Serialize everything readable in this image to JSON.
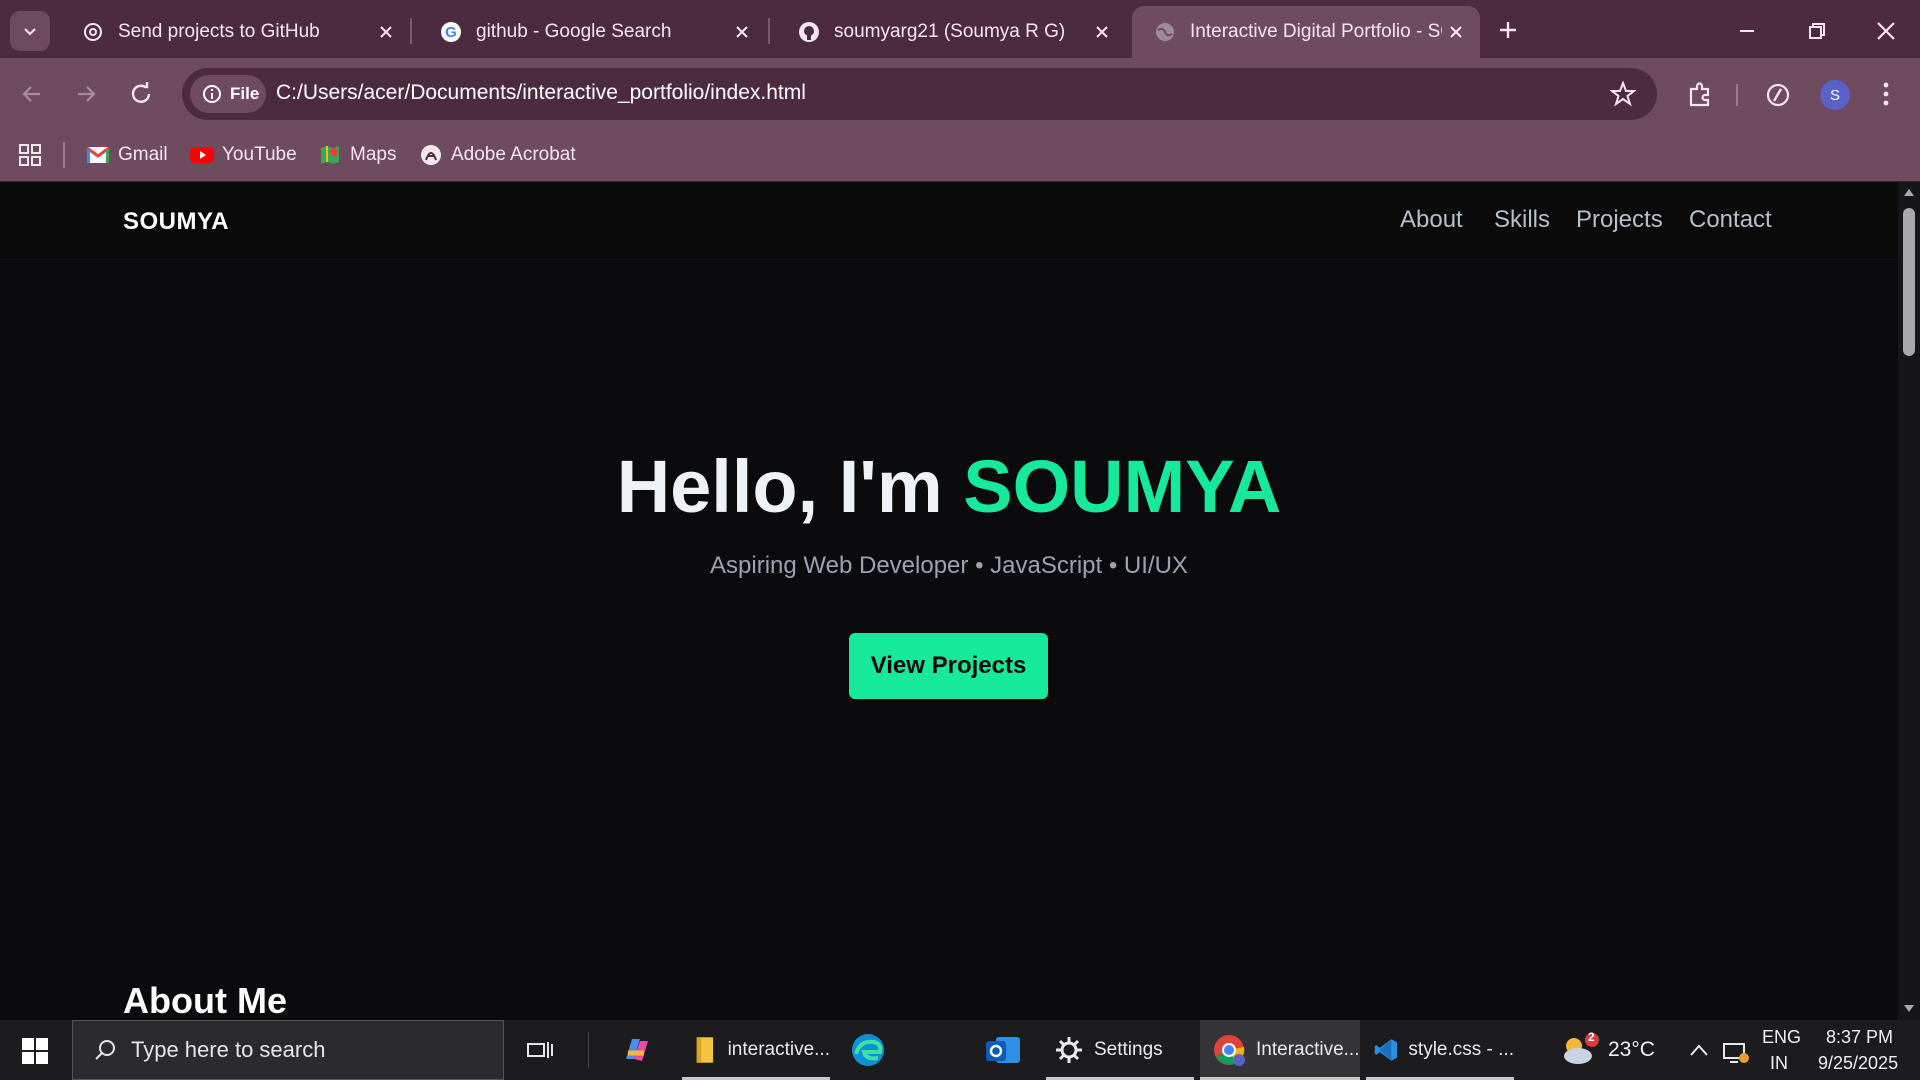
{
  "browser": {
    "tabs": [
      {
        "title": "Send projects to GitHub",
        "favicon": "openai-icon"
      },
      {
        "title": "github - Google Search",
        "favicon": "google-icon"
      },
      {
        "title": "soumyarg21 (Soumya R G)",
        "favicon": "github-icon"
      },
      {
        "title": "Interactive Digital Portfolio - SO",
        "favicon": "globe-icon",
        "active": true
      }
    ],
    "address": {
      "chip": "File",
      "url": "C:/Users/acer/Documents/interactive_portfolio/index.html"
    },
    "profile_initial": "S",
    "bookmarks": [
      {
        "label": "Gmail",
        "icon": "gmail-icon"
      },
      {
        "label": "YouTube",
        "icon": "youtube-icon"
      },
      {
        "label": "Maps",
        "icon": "maps-icon"
      },
      {
        "label": "Adobe Acrobat",
        "icon": "acrobat-icon"
      }
    ]
  },
  "site": {
    "brand": "SOUMYA",
    "nav": [
      "About",
      "Skills",
      "Projects",
      "Contact"
    ],
    "hero": {
      "greeting": "Hello, I'm ",
      "name": "SOUMYA",
      "subtitle": "Aspiring Web Developer • JavaScript • UI/UX",
      "cta": "View Projects"
    },
    "about_heading": "About Me",
    "colors": {
      "accent": "#16e89c",
      "background": "#0b0b0e"
    }
  },
  "taskbar": {
    "search_placeholder": "Type here to search",
    "apps": [
      {
        "label": "",
        "icon": "copilot-icon"
      },
      {
        "label": "interactive...",
        "icon": "folder-icon"
      },
      {
        "label": "",
        "icon": "edge-icon"
      },
      {
        "label": "",
        "icon": "outlook-icon"
      },
      {
        "label": "Settings",
        "icon": "gear-icon"
      },
      {
        "label": "Interactive...",
        "icon": "chrome-icon"
      },
      {
        "label": "style.css - ...",
        "icon": "vscode-icon"
      }
    ],
    "weather": {
      "temp": "23°C",
      "badge": "2"
    },
    "lang": {
      "line1": "ENG",
      "line2": "IN"
    },
    "clock": {
      "time": "8:37 PM",
      "date": "9/25/2025"
    }
  }
}
